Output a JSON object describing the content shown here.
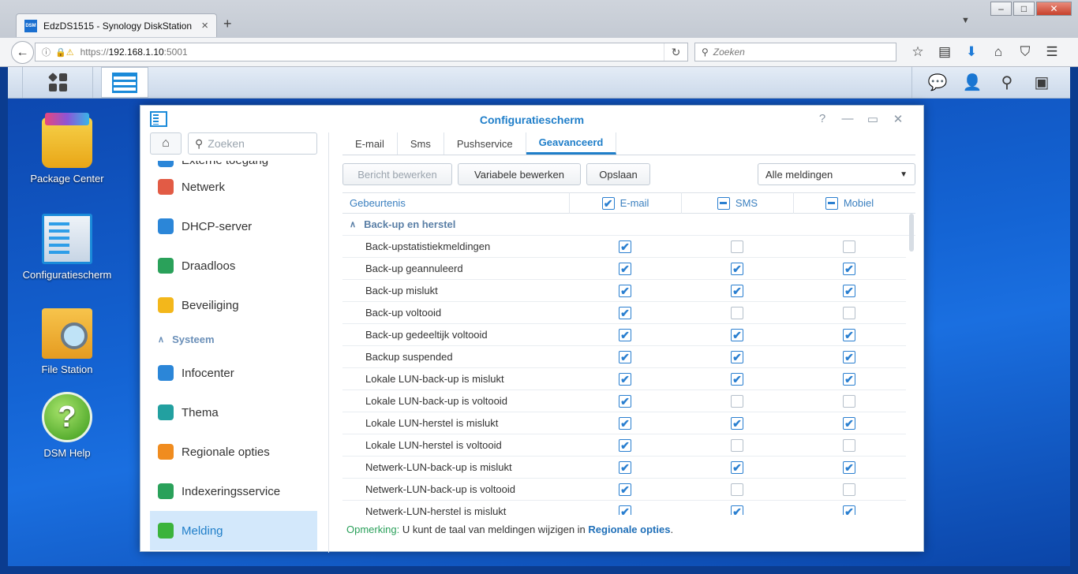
{
  "browser": {
    "tab_title": "EdzDS1515 - Synology DiskStation",
    "favicon_text": "DSM",
    "new_tab": "+",
    "url_scheme": "https://",
    "url_host": "192.168.1.10",
    "url_port": ":5001",
    "search_placeholder": "Zoeken"
  },
  "desktop": {
    "icons": [
      {
        "label": "Package Center"
      },
      {
        "label": "Configuratiescherm"
      },
      {
        "label": "File Station"
      },
      {
        "label": "DSM Help"
      }
    ]
  },
  "window": {
    "title": "Configuratiescherm",
    "sidebar": {
      "search_placeholder": "Zoeken",
      "partial_item": "Externe toegang",
      "items": [
        {
          "label": "Netwerk",
          "icon": "network-icon",
          "color": "#e25b45"
        },
        {
          "label": "DHCP-server",
          "icon": "dhcp-icon",
          "color": "#2b86d8"
        },
        {
          "label": "Draadloos",
          "icon": "wireless-icon",
          "color": "#2aa15a"
        },
        {
          "label": "Beveiliging",
          "icon": "shield-icon",
          "color": "#f3b71b"
        }
      ],
      "group": "Systeem",
      "system_items": [
        {
          "label": "Infocenter",
          "icon": "info-icon",
          "color": "#2b86d8"
        },
        {
          "label": "Thema",
          "icon": "palette-icon",
          "color": "#22a0a0"
        },
        {
          "label": "Regionale opties",
          "icon": "regional-icon",
          "color": "#f08c1f"
        },
        {
          "label": "Indexeringsservice",
          "icon": "index-icon",
          "color": "#2aa15a"
        },
        {
          "label": "Melding",
          "icon": "notification-icon",
          "color": "#3bb33b"
        }
      ]
    },
    "tabs": [
      "E-mail",
      "Sms",
      "Pushservice",
      "Geavanceerd"
    ],
    "active_tab": "Geavanceerd",
    "toolbar": {
      "edit_message": "Bericht bewerken",
      "edit_variables": "Variabele bewerken",
      "save": "Opslaan",
      "filter_value": "Alle meldingen"
    },
    "grid": {
      "columns": [
        "Gebeurtenis",
        "E-mail",
        "SMS",
        "Mobiel"
      ],
      "header_state": [
        "checked",
        "partial",
        "partial"
      ],
      "group": "Back-up en herstel",
      "rows": [
        {
          "name": "Back-upstatistiekmeldingen",
          "email": true,
          "sms": false,
          "mobile": false
        },
        {
          "name": "Back-up geannuleerd",
          "email": true,
          "sms": true,
          "mobile": true
        },
        {
          "name": "Back-up mislukt",
          "email": true,
          "sms": true,
          "mobile": true
        },
        {
          "name": "Back-up voltooid",
          "email": true,
          "sms": false,
          "mobile": false
        },
        {
          "name": "Back-up gedeeltijk voltooid",
          "email": true,
          "sms": true,
          "mobile": true
        },
        {
          "name": "Backup suspended",
          "email": true,
          "sms": true,
          "mobile": true
        },
        {
          "name": "Lokale LUN-back-up is mislukt",
          "email": true,
          "sms": true,
          "mobile": true
        },
        {
          "name": "Lokale LUN-back-up is voltooid",
          "email": true,
          "sms": false,
          "mobile": false
        },
        {
          "name": "Lokale LUN-herstel is mislukt",
          "email": true,
          "sms": true,
          "mobile": true
        },
        {
          "name": "Lokale LUN-herstel is voltooid",
          "email": true,
          "sms": false,
          "mobile": false
        },
        {
          "name": "Netwerk-LUN-back-up is mislukt",
          "email": true,
          "sms": true,
          "mobile": true
        },
        {
          "name": "Netwerk-LUN-back-up is voltooid",
          "email": true,
          "sms": false,
          "mobile": false
        },
        {
          "name": "Netwerk-LUN-herstel is mislukt",
          "email": true,
          "sms": true,
          "mobile": true
        }
      ]
    },
    "note": {
      "label": "Opmerking:",
      "text": " U kunt de taal van meldingen wijzigen in ",
      "link": "Regionale opties",
      "end": "."
    }
  }
}
